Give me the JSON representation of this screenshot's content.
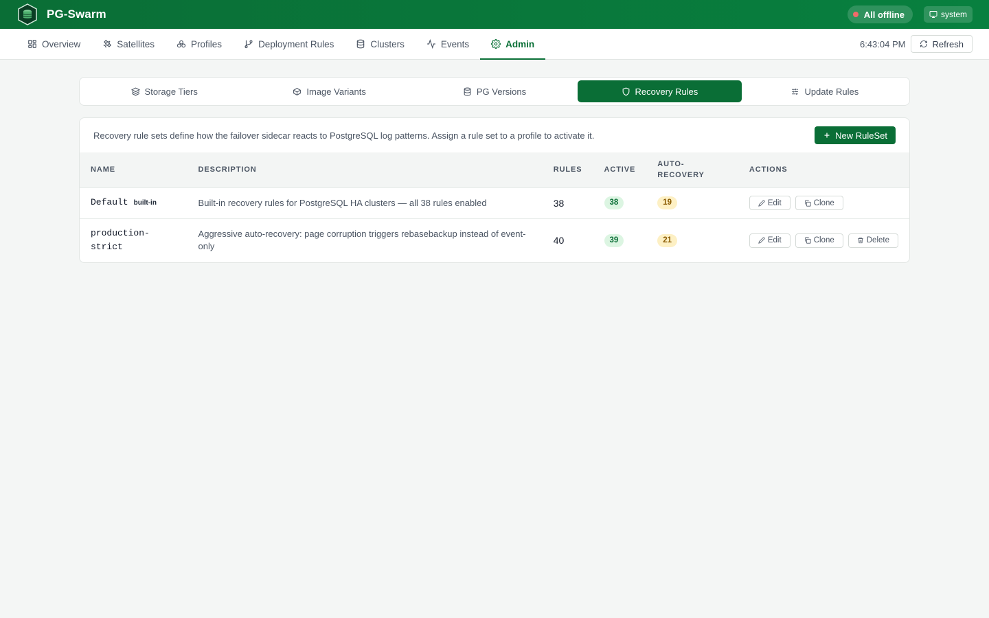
{
  "app": {
    "title": "PG-Swarm",
    "status": "All offline",
    "user": "system"
  },
  "nav": {
    "items": [
      {
        "label": "Overview",
        "icon": "grid-icon"
      },
      {
        "label": "Satellites",
        "icon": "satellite-icon"
      },
      {
        "label": "Profiles",
        "icon": "profiles-icon"
      },
      {
        "label": "Deployment Rules",
        "icon": "git-branch-icon"
      },
      {
        "label": "Clusters",
        "icon": "database-icon"
      },
      {
        "label": "Events",
        "icon": "activity-icon"
      },
      {
        "label": "Admin",
        "icon": "gear-icon",
        "active": true
      }
    ],
    "time": "6:43:04 PM",
    "refresh_label": "Refresh"
  },
  "subtabs": [
    {
      "label": "Storage Tiers",
      "icon": "layers-icon"
    },
    {
      "label": "Image Variants",
      "icon": "box-icon"
    },
    {
      "label": "PG Versions",
      "icon": "database-icon"
    },
    {
      "label": "Recovery Rules",
      "icon": "shield-icon",
      "active": true
    },
    {
      "label": "Update Rules",
      "icon": "sliders-icon"
    }
  ],
  "panel": {
    "description": "Recovery rule sets define how the failover sidecar reacts to PostgreSQL log patterns. Assign a rule set to a profile to activate it.",
    "new_button": "New RuleSet"
  },
  "table": {
    "columns": {
      "name": "NAME",
      "description": "DESCRIPTION",
      "rules": "RULES",
      "active": "ACTIVE",
      "auto_recovery_1": "AUTO-",
      "auto_recovery_2": "RECOVERY",
      "actions": "ACTIONS"
    },
    "rows": [
      {
        "name": "Default",
        "tag": "built-in",
        "description": "Built-in recovery rules for PostgreSQL HA clusters — all 38 rules enabled",
        "rules": "38",
        "active": "38",
        "auto_recovery": "19",
        "actions": {
          "edit": "Edit",
          "clone": "Clone"
        }
      },
      {
        "name_line1": "production-",
        "name_line2": "strict",
        "description_line1": "Aggressive auto-recovery: page corruption triggers rebasebackup instead of event-",
        "description_line2": "only",
        "rules": "40",
        "active": "39",
        "auto_recovery": "21",
        "actions": {
          "edit": "Edit",
          "clone": "Clone",
          "delete": "Delete"
        }
      }
    ]
  },
  "colors": {
    "brand": "#0a6e36",
    "status_offline": "#f26a6a",
    "badge_green": "#dcf5e2",
    "badge_yellow": "#fdf0c4"
  }
}
